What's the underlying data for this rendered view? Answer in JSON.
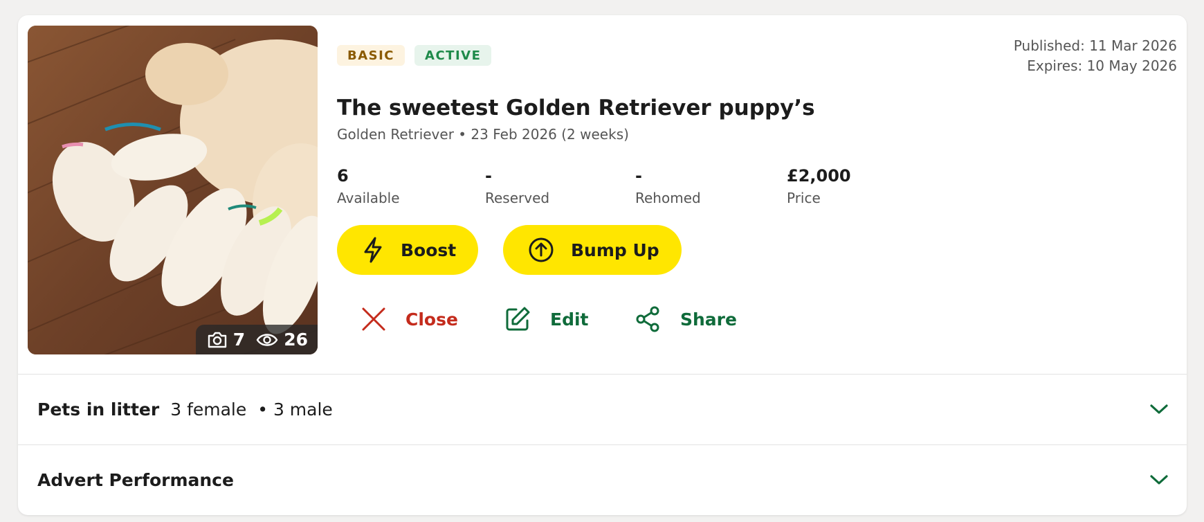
{
  "listing": {
    "photo": {
      "photo_count": "7",
      "view_count": "26",
      "alt": "Golden retriever puppies nursing"
    },
    "badges": {
      "tier": "BASIC",
      "status": "ACTIVE"
    },
    "published": "Published: 11 Mar 2026",
    "expires": "Expires: 10 May 2026",
    "title": "The sweetest Golden Retriever puppy’s",
    "subtitle": "Golden Retriever • 23 Feb 2026 (2 weeks)",
    "stats": [
      {
        "value": "6",
        "label": "Available"
      },
      {
        "value": "-",
        "label": "Reserved"
      },
      {
        "value": "-",
        "label": "Rehomed"
      },
      {
        "value": "£2,000",
        "label": "Price"
      }
    ],
    "primary_buttons": {
      "boost": "Boost",
      "bump_up": "Bump Up"
    },
    "actions": {
      "close": "Close",
      "edit": "Edit",
      "share": "Share"
    }
  },
  "accordions": {
    "litter": {
      "heading": "Pets in litter",
      "female": "3 female",
      "male": "• 3 male"
    },
    "performance": {
      "heading": "Advert Performance"
    }
  },
  "colors": {
    "accent_yellow": "#ffe600",
    "action_green": "#0f6b3a",
    "close_red": "#c42b1c",
    "badge_basic_bg": "#fdf3e0",
    "badge_active_bg": "#e7f4ec"
  },
  "icons": [
    "camera-icon",
    "eye-icon",
    "lightning-icon",
    "arrow-up-circle-icon",
    "close-x-icon",
    "edit-pencil-icon",
    "share-icon",
    "chevron-down-icon"
  ]
}
